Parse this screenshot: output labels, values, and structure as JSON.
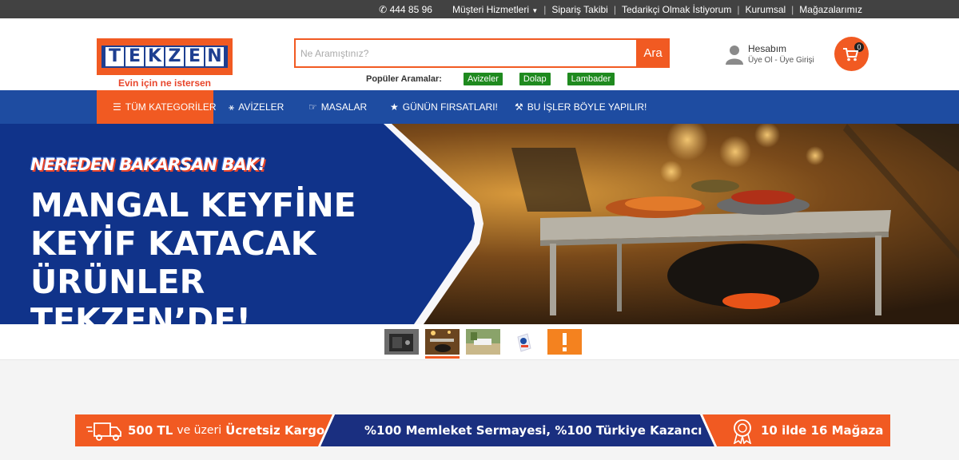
{
  "topbar": {
    "phone": "444 85 96",
    "customer_service": "Müşteri Hizmetleri",
    "links": [
      "Sipariş Takibi",
      "Tedarikçi Olmak İstiyorum",
      "Kurumsal",
      "Mağazalarımız"
    ]
  },
  "brand": {
    "logo_letters": [
      "T",
      "E",
      "K",
      "Z",
      "E",
      "N"
    ],
    "slogan": "Evin için ne istersen"
  },
  "search": {
    "placeholder": "Ne Aramıştınız?",
    "button": "Ara",
    "popular_label": "Popüler Aramalar:",
    "popular_tags": [
      "Avizeler",
      "Dolap",
      "Lambader"
    ]
  },
  "account": {
    "title": "Hesabım",
    "subtitle": "Üye Ol - Üye Girişi"
  },
  "cart": {
    "count": "0"
  },
  "nav": {
    "all_categories": "TÜM KATEGORİLER",
    "items": [
      "AVİZELER",
      "MASALAR",
      "GÜNÜN FIRSATLARI!",
      "BU İŞLER BÖYLE YAPILIR!"
    ]
  },
  "hero": {
    "tagline": "NEREDEN BAKARSAN BAK!",
    "headline_lines": [
      "MANGAL KEYFİNE",
      "KEYİF KATACAK",
      "ÜRÜNLER TEKZEN’DE!"
    ]
  },
  "thumbnails": {
    "count": 5,
    "active_index": 1
  },
  "benefits": {
    "shipping_amount": "500 TL",
    "shipping_middle": "ve üzeri",
    "shipping_free": "Ücretsiz Kargo",
    "capital": "%100 Memleket Sermayesi, %100 Türkiye Kazancı",
    "stores": "10 ilde 16 Mağaza"
  },
  "colors": {
    "brand_orange": "#f15a22",
    "brand_blue": "#1e4ca1",
    "tag_green": "#1f8a1f",
    "topbar_dark": "#424242"
  }
}
